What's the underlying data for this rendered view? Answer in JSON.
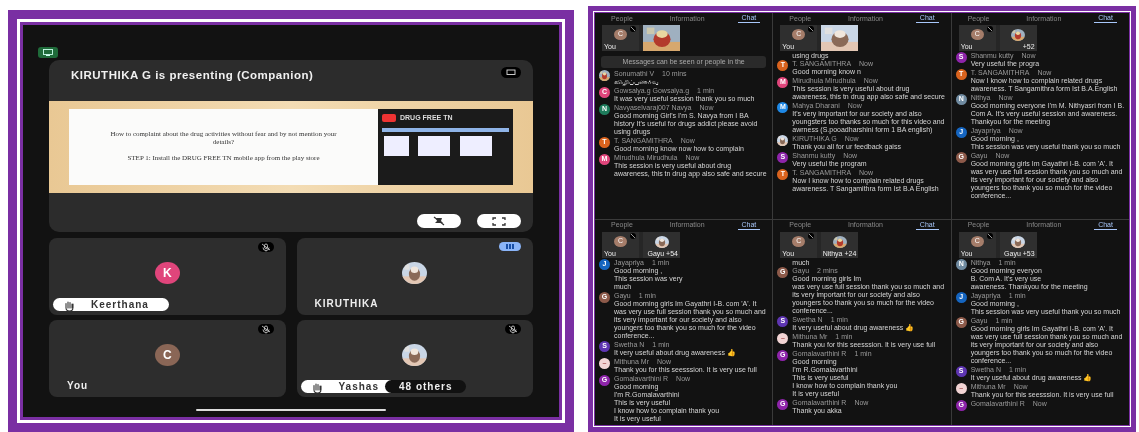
{
  "presentation_view": {
    "title": "KIRUTHIKA G is presenting (Companion)",
    "slide": {
      "question": "How to complaint about the drug activities without fear and by not mention your details?",
      "step": "STEP 1: Install the DRUG FREE TN mobile app from the play store",
      "app_name": "DRUG FREE TN"
    },
    "tiles": [
      {
        "name": "Keerthana",
        "avatar": {
          "kind": "letter",
          "letter": "K",
          "color": "#e0457b"
        },
        "hand_raised": true,
        "muted": true,
        "speaking": false
      },
      {
        "name": "KIRUTHIKA",
        "avatar": {
          "kind": "picture"
        },
        "hand_raised": false,
        "muted": false,
        "speaking": true
      },
      {
        "name": "You",
        "avatar": {
          "kind": "letter",
          "letter": "C",
          "color": "#8a6656"
        },
        "hand_raised": false,
        "muted": true,
        "speaking": false
      },
      {
        "name": "Yashas",
        "avatar": {
          "kind": "picture"
        },
        "hand_raised": true,
        "muted": true,
        "speaking": false,
        "others": "48 others"
      }
    ]
  },
  "chat_panels": [
    {
      "tabs": [
        {
          "label": "People",
          "selected": false
        },
        {
          "label": "Information",
          "selected": false
        },
        {
          "label": "Chat",
          "selected": true
        }
      ],
      "notice": "Messages can be seen or people in the",
      "overlay": {
        "self_label": "You",
        "self_letter": "C"
      },
      "messages": [
        {
          "author": "Sonumathi V",
          "time": "10 mins",
          "lines": [
            "விழிப்புணர்வு"
          ],
          "avatar": {
            "kind": "picture"
          }
        },
        {
          "author": "Gowsalya.g Gowsalya.g",
          "time": "1 min",
          "lines": [
            "It was very useful session thank you so much"
          ],
          "avatar": {
            "kind": "letter",
            "letter": "C",
            "color": "#e0457b"
          }
        },
        {
          "author": "Navyaselvaraj007 Navya",
          "time": "Now",
          "lines": [
            "Good morning Girl's I'm S. Navya from I BA history It's useful for drugs addict please avoid using drugs"
          ],
          "avatar": {
            "kind": "letter",
            "letter": "N",
            "color": "#1e7c5c"
          }
        },
        {
          "author": "T. SANGAMITHRA",
          "time": "Now",
          "lines": [
            "Good morning know now how to complain"
          ],
          "avatar": {
            "kind": "letter",
            "letter": "T",
            "color": "#d9631e"
          }
        },
        {
          "author": "Mirudhula Mirudhula",
          "time": "Now",
          "lines": [
            "This session is very useful about drug awareness, this tn drug app also safe and secure"
          ],
          "avatar": {
            "kind": "letter",
            "letter": "M",
            "color": "#e0457b"
          }
        }
      ]
    },
    {
      "tabs": [
        {
          "label": "People",
          "selected": false
        },
        {
          "label": "Information",
          "selected": false
        },
        {
          "label": "Chat",
          "selected": true
        }
      ],
      "lead_lines": [
        "using drugs"
      ],
      "overlay": {
        "self_label": "You",
        "self_letter": "C"
      },
      "messages": [
        {
          "author": "T. SANGAMITHRA",
          "time": "Now",
          "lines": [
            "Good morning know n"
          ],
          "avatar": {
            "kind": "letter",
            "letter": "T",
            "color": "#d9631e"
          }
        },
        {
          "author": "Mirudhula Mirudhula",
          "time": "Now",
          "lines": [
            "This session is very useful about drug awareness, this tn drug app also safe and secure"
          ],
          "avatar": {
            "kind": "letter",
            "letter": "M",
            "color": "#e0457b"
          }
        },
        {
          "author": "Mahya Dharani",
          "time": "Now",
          "lines": [
            "It's very important for our society and also youngsters too thanks so much for this video and awrness (S.pooadharshini form 1 BA english)"
          ],
          "avatar": {
            "kind": "letter",
            "letter": "M",
            "color": "#1e88e5"
          }
        },
        {
          "author": "KIRUTHIKA G",
          "time": "Now",
          "lines": [
            "Thank you all for ur feedback gaiss"
          ],
          "avatar": {
            "kind": "picture"
          }
        },
        {
          "author": "Shanmu kutty",
          "time": "Now",
          "lines": [
            "Very useful the program"
          ],
          "avatar": {
            "kind": "letter",
            "letter": "S",
            "color": "#8e24aa"
          }
        },
        {
          "author": "T. SANGAMITHRA",
          "time": "Now",
          "lines": [
            "Now I know how to complain related drugs awareness. T Sangamithra form Ist B.A English"
          ],
          "avatar": {
            "kind": "letter",
            "letter": "T",
            "color": "#d9631e"
          }
        }
      ]
    },
    {
      "tabs": [
        {
          "label": "People",
          "selected": false
        },
        {
          "label": "Information",
          "selected": false
        },
        {
          "label": "Chat",
          "selected": true
        }
      ],
      "overlay": {
        "self_label": "You",
        "self_letter": "C",
        "other_label": "+52"
      },
      "messages": [
        {
          "author": "Shanmu kutty",
          "time": "Now",
          "lines": [
            "Very useful the progra"
          ],
          "avatar": {
            "kind": "letter",
            "letter": "S",
            "color": "#8e24aa"
          }
        },
        {
          "author": "T. SANGAMITHRA",
          "time": "Now",
          "lines": [
            "Now I know how to complain related drugs awareness. T Sangamithra form Ist B.A.English"
          ],
          "avatar": {
            "kind": "letter",
            "letter": "T",
            "color": "#d9631e"
          }
        },
        {
          "author": "Nithya",
          "time": "Now",
          "lines": [
            "Good morning everyone I'm M. Nithyasri from I B. Com A. It's very useful session and awareness. Thankyou for the meeting"
          ],
          "avatar": {
            "kind": "letter",
            "letter": "N",
            "color": "#6f8aa0"
          }
        },
        {
          "author": "Jayapriya",
          "time": "Now",
          "lines": [
            "Good morning ,",
            "This session was very useful thank you so much"
          ],
          "avatar": {
            "kind": "letter",
            "letter": "J",
            "color": "#1565c0"
          }
        },
        {
          "author": "Gayu",
          "time": "Now",
          "lines": [
            "Good morning girls Im Gayathri I-B. com 'A'. It was very use full session thank you so much and its very important for our society and also youngers too thank you so much for the video conference..."
          ],
          "avatar": {
            "kind": "letter",
            "letter": "G",
            "color": "#8d5a4a"
          }
        }
      ]
    },
    {
      "tabs": [
        {
          "label": "People",
          "selected": false
        },
        {
          "label": "Information",
          "selected": false
        },
        {
          "label": "Chat",
          "selected": true
        }
      ],
      "overlay": {
        "self_label": "You",
        "self_letter": "C",
        "other_label": "Gayu +54"
      },
      "messages": [
        {
          "author": "Jayapriya",
          "time": "1 min",
          "lines": [
            "Good morning ,",
            "This session was very",
            "much"
          ],
          "avatar": {
            "kind": "letter",
            "letter": "J",
            "color": "#1565c0"
          }
        },
        {
          "author": "Gayu",
          "time": "1 min",
          "lines": [
            "Good morning girls Im Gayathri I-B. com 'A'. It was very use full session thank you so much and its very important for our society and also youngers too thank you so much for the video conference..."
          ],
          "avatar": {
            "kind": "letter",
            "letter": "G",
            "color": "#8d5a4a"
          }
        },
        {
          "author": "Swetha N",
          "time": "1 min",
          "lines": [
            "It very useful about drug awareness 👍"
          ],
          "avatar": {
            "kind": "letter",
            "letter": "S",
            "color": "#5e35b1"
          }
        },
        {
          "author": "Mithuna Mr",
          "time": "Now",
          "lines": [
            "Thank you for this seesssion. It is very use full"
          ],
          "avatar": {
            "kind": "letter",
            "letter": "–",
            "color": "#f2d4d4"
          }
        },
        {
          "author": "Gomalavarthini R",
          "time": "Now",
          "lines": [
            "Good morning",
            "I'm R.Gomalavarthini",
            "This is very useful",
            "I know how to complain thank you",
            "It is very useful"
          ],
          "avatar": {
            "kind": "letter",
            "letter": "G",
            "color": "#8e24aa"
          }
        }
      ]
    },
    {
      "tabs": [
        {
          "label": "People",
          "selected": false
        },
        {
          "label": "Information",
          "selected": false
        },
        {
          "label": "Chat",
          "selected": true
        }
      ],
      "lead_lines": [
        "much"
      ],
      "overlay": {
        "self_label": "You",
        "self_letter": "C",
        "other_label": "Nithya +24"
      },
      "messages": [
        {
          "author": "Gayu",
          "time": "2 mins",
          "lines": [
            "Good morning girls Im",
            "was very use full session thank you so much and its very important for our society and also youngers too thank you so much for the video conference..."
          ],
          "avatar": {
            "kind": "letter",
            "letter": "G",
            "color": "#8d5a4a"
          }
        },
        {
          "author": "Swetha N",
          "time": "1 min",
          "lines": [
            "It very useful about drug awareness 👍"
          ],
          "avatar": {
            "kind": "letter",
            "letter": "S",
            "color": "#5e35b1"
          }
        },
        {
          "author": "Mithuna Mr",
          "time": "1 min",
          "lines": [
            "Thank you for this seesssion. It is very use full"
          ],
          "avatar": {
            "kind": "letter",
            "letter": "–",
            "color": "#f2d4d4"
          }
        },
        {
          "author": "Gomalavarthini R",
          "time": "1 min",
          "lines": [
            "Good morning",
            "I'm R.Gomalavarthini",
            "This is very useful",
            "I know how to complain thank you",
            "It is very useful"
          ],
          "avatar": {
            "kind": "letter",
            "letter": "G",
            "color": "#8e24aa"
          }
        },
        {
          "author": "Gomalavarthini R",
          "time": "Now",
          "lines": [
            "Thank you akka"
          ],
          "avatar": {
            "kind": "letter",
            "letter": "G",
            "color": "#8e24aa"
          }
        }
      ]
    },
    {
      "tabs": [
        {
          "label": "People",
          "selected": false
        },
        {
          "label": "Information",
          "selected": false
        },
        {
          "label": "Chat",
          "selected": true
        }
      ],
      "overlay": {
        "self_label": "You",
        "self_letter": "C",
        "other_label": "Gayu +53"
      },
      "messages": [
        {
          "author": "Nithya",
          "time": "1 min",
          "lines": [
            "Good morning everyon",
            "B. Com A. It's very use",
            "awareness. Thankyou for the meeting"
          ],
          "avatar": {
            "kind": "letter",
            "letter": "N",
            "color": "#6f8aa0"
          }
        },
        {
          "author": "Jayapriya",
          "time": "1 min",
          "lines": [
            "Good morning ,",
            "This session was very useful thank you so much"
          ],
          "avatar": {
            "kind": "letter",
            "letter": "J",
            "color": "#1565c0"
          }
        },
        {
          "author": "Gayu",
          "time": "1 min",
          "lines": [
            "Good morning girls Im Gayathri I-B. com 'A'. It was very use full session thank you so much and its very important for our society and also youngers too thank you so much for the video conference..."
          ],
          "avatar": {
            "kind": "letter",
            "letter": "G",
            "color": "#8d5a4a"
          }
        },
        {
          "author": "Swetha N",
          "time": "1 min",
          "lines": [
            "It very useful about drug awareness 👍"
          ],
          "avatar": {
            "kind": "letter",
            "letter": "S",
            "color": "#5e35b1"
          }
        },
        {
          "author": "Mithuna Mr",
          "time": "Now",
          "lines": [
            "Thank you for this seesssion. It is very use full"
          ],
          "avatar": {
            "kind": "letter",
            "letter": "–",
            "color": "#f2d4d4"
          }
        },
        {
          "author": "Gomalavarthini R",
          "time": "Now",
          "avatar": {
            "kind": "letter",
            "letter": "G",
            "color": "#8e24aa"
          }
        }
      ]
    }
  ]
}
